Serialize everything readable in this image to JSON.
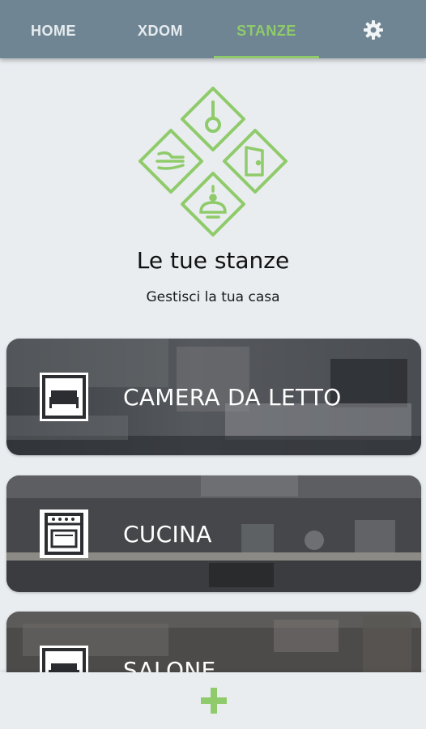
{
  "tabs": [
    {
      "label": "HOME",
      "active": false
    },
    {
      "label": "XDOM",
      "active": false
    },
    {
      "label": "STANZE",
      "active": true
    }
  ],
  "settings_icon": "gear-icon",
  "hero": {
    "title": "Le tue stanze",
    "subtitle": "Gestisci la tua casa",
    "logo_icons": [
      "thermometer-icon",
      "air-conditioner-icon",
      "door-icon",
      "light-bulb-icon"
    ]
  },
  "rooms": [
    {
      "name": "CAMERA DA LETTO",
      "icon": "bed-icon"
    },
    {
      "name": "CUCINA",
      "icon": "oven-icon"
    },
    {
      "name": "SALONE",
      "icon": "sofa-icon"
    }
  ],
  "add_icon": "plus-icon",
  "colors": {
    "accent": "#8fcb6a",
    "topbar": "#6f8593",
    "background": "#e9edf0"
  }
}
